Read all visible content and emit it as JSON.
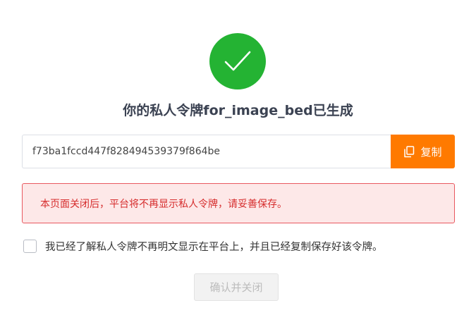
{
  "dialog": {
    "icon": "checkmark-icon",
    "title": "你的私人令牌for_image_bed已生成",
    "token": {
      "value": "f73ba1fccd447f828494539379f864be"
    },
    "copy_button": {
      "label": "复制",
      "icon": "copy-icon"
    },
    "warning": "本页面关闭后，平台将不再显示私人令牌，请妥善保存。",
    "acknowledge": {
      "label": "我已经了解私人令牌不再明文显示在平台上，并且已经复制保存好该令牌。",
      "checked": false
    },
    "confirm_button": {
      "label": "确认并关闭",
      "disabled": true
    }
  },
  "colors": {
    "success": "#24b333",
    "accent": "#ff7a00",
    "warning_text": "#d62d2d",
    "warning_border": "#e8585f",
    "warning_bg": "#fde8e8"
  }
}
